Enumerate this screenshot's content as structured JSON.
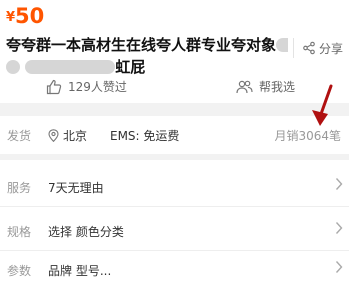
{
  "price": {
    "currency": "¥",
    "value": "50"
  },
  "title": {
    "line1": "夸夸群一本高材生在线夸人群专业夸对象",
    "line2_tail": "虹屁"
  },
  "share": {
    "icon": "share-icon",
    "label": "分享"
  },
  "likes": {
    "icon": "thumbs-up-icon",
    "label": "129人赞过"
  },
  "help_choose": {
    "icon": "people-icon",
    "label": "帮我选"
  },
  "shipping": {
    "label": "发货",
    "location_icon": "location-pin-icon",
    "location": "北京",
    "method": "EMS: 免运费",
    "monthly_sales": "月销3064笔"
  },
  "details": {
    "service": {
      "label": "服务",
      "value": "7天无理由"
    },
    "spec": {
      "label": "规格",
      "value": "选择 颜色分类"
    },
    "params": {
      "label": "参数",
      "value": "品牌 型号..."
    }
  },
  "colors": {
    "accent": "#ff5500",
    "annotation_arrow": "#b01010"
  }
}
